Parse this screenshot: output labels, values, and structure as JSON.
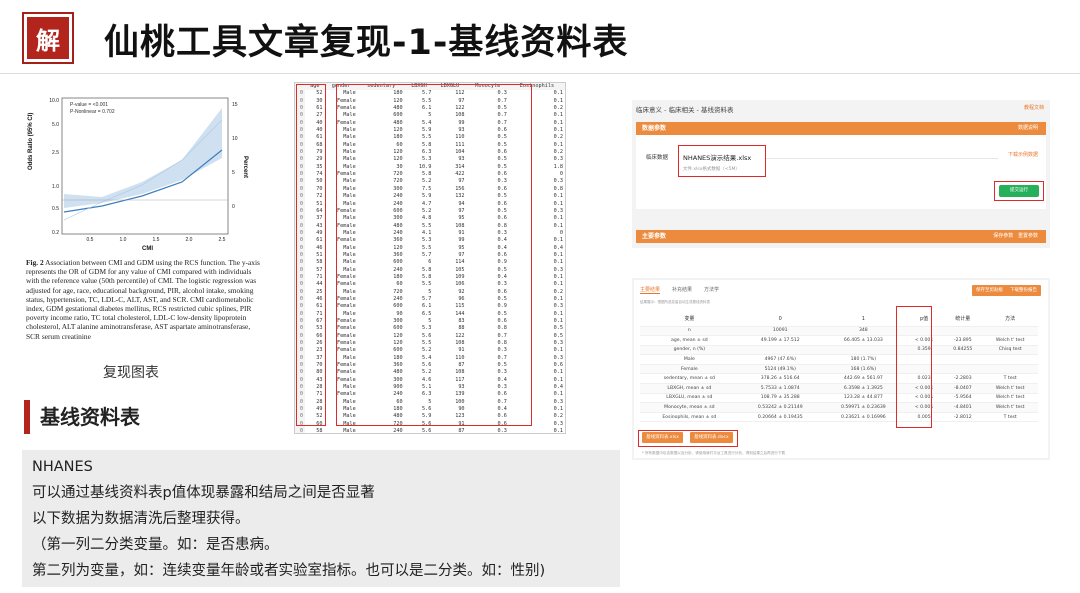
{
  "logo_glyph": "解",
  "page_title": "仙桃工具文章复现-1-基线资料表",
  "figure": {
    "stats1": "P-value = <0.001",
    "stats2": "P-Nonlinear = 0.702",
    "ylabel_left": "Odds Ratio (95% CI)",
    "ylabel_right": "Percent",
    "xlabel": "CMI",
    "y_ticks": [
      "10.0",
      "5.0",
      "2.5",
      "1.0",
      "0.5",
      "0.2"
    ],
    "x_ticks": [
      "0.5",
      "1.0",
      "1.5",
      "2.0",
      "2.5"
    ],
    "right_ticks": [
      "15",
      "10",
      "5",
      "0"
    ],
    "caption_head": "Fig. 2",
    "caption": "Association between CMI and GDM using the RCS function. The y-axis represents the OR of GDM for any value of CMI compared with individuals with the reference value (50th percentile) of CMI. The logistic regression was adjusted for age, race, educational background, PIR, alcohol intake, smoking status, hypertension, TC, LDL-C, ALT, AST, and SCR. CMI cardiometabolic index, GDM gestational diabetes mellitus, RCS restricted cubic splines, PIR poverty income ratio, TC total cholesterol, LDL-C low-density lipoprotein cholesterol, ALT alanine aminotransferase, AST aspartate aminotransferase, SCR serum creatinine",
    "label": "复现图表"
  },
  "section_title": "基线资料表",
  "notes": [
    "NHANES",
    "可以通过基线资料表p值体现暴露和结局之间是否显著",
    "以下数据为数据清洗后整理获得。",
    "（第一列二分类变量。如：是否患病。",
    "第二列为变量，如：连续变量年龄或者实验室指标。也可以是二分类。如：性别)"
  ],
  "sheet": {
    "headers": [
      "",
      "age",
      "gender",
      "sedentary",
      "LBXGH",
      "LBXGLU",
      "Monocyte",
      "Eosinophils"
    ],
    "rows": [
      [
        "0",
        "52",
        "Male",
        "180",
        "5.7",
        "112",
        "0.3",
        "0.1"
      ],
      [
        "0",
        "30",
        "Female",
        "120",
        "5.5",
        "97",
        "0.7",
        "0.1"
      ],
      [
        "0",
        "61",
        "Female",
        "480",
        "6.1",
        "122",
        "0.5",
        "0.2"
      ],
      [
        "0",
        "27",
        "Male",
        "600",
        "5",
        "108",
        "0.7",
        "0.1"
      ],
      [
        "0",
        "40",
        "Female",
        "480",
        "5.4",
        "99",
        "0.7",
        "0.1"
      ],
      [
        "0",
        "40",
        "Male",
        "120",
        "5.9",
        "93",
        "0.6",
        "0.1"
      ],
      [
        "0",
        "61",
        "Male",
        "180",
        "5.5",
        "110",
        "0.5",
        "0.2"
      ],
      [
        "0",
        "68",
        "Male",
        "60",
        "5.8",
        "111",
        "0.5",
        "0.1"
      ],
      [
        "0",
        "79",
        "Male",
        "120",
        "6.3",
        "104",
        "0.6",
        "0.2"
      ],
      [
        "0",
        "29",
        "Male",
        "120",
        "5.3",
        "93",
        "0.5",
        "0.3"
      ],
      [
        "0",
        "35",
        "Male",
        "30",
        "10.9",
        "314",
        "0.5",
        "1.8"
      ],
      [
        "0",
        "74",
        "Female",
        "720",
        "5.8",
        "422",
        "0.6",
        "0"
      ],
      [
        "0",
        "50",
        "Male",
        "720",
        "5.2",
        "97",
        "0.3",
        "0.3"
      ],
      [
        "0",
        "70",
        "Male",
        "300",
        "7.5",
        "156",
        "0.6",
        "0.8"
      ],
      [
        "0",
        "72",
        "Male",
        "240",
        "5.9",
        "132",
        "0.5",
        "0.1"
      ],
      [
        "0",
        "51",
        "Male",
        "240",
        "4.7",
        "94",
        "0.6",
        "0.1"
      ],
      [
        "0",
        "64",
        "Female",
        "600",
        "5.2",
        "97",
        "0.5",
        "0.3"
      ],
      [
        "0",
        "37",
        "Male",
        "300",
        "4.8",
        "95",
        "0.6",
        "0.1"
      ],
      [
        "0",
        "43",
        "Female",
        "480",
        "5.5",
        "108",
        "0.8",
        "0.1"
      ],
      [
        "0",
        "49",
        "Male",
        "240",
        "4.1",
        "91",
        "0.3",
        "0"
      ],
      [
        "0",
        "61",
        "Female",
        "360",
        "5.3",
        "99",
        "0.4",
        "0.1"
      ],
      [
        "0",
        "46",
        "Male",
        "120",
        "5.5",
        "95",
        "0.4",
        "0.4"
      ],
      [
        "0",
        "51",
        "Male",
        "360",
        "5.7",
        "97",
        "0.6",
        "0.1"
      ],
      [
        "0",
        "58",
        "Male",
        "600",
        "6",
        "114",
        "0.9",
        "0.1"
      ],
      [
        "0",
        "57",
        "Male",
        "240",
        "5.8",
        "105",
        "0.5",
        "0.3"
      ],
      [
        "0",
        "71",
        "Female",
        "180",
        "5.8",
        "109",
        "0.4",
        "0.1"
      ],
      [
        "0",
        "44",
        "Female",
        "60",
        "5.5",
        "106",
        "0.3",
        "0.1"
      ],
      [
        "0",
        "25",
        "Male",
        "720",
        "5",
        "92",
        "0.6",
        "0.2"
      ],
      [
        "0",
        "46",
        "Female",
        "240",
        "5.7",
        "96",
        "0.5",
        "0.1"
      ],
      [
        "0",
        "61",
        "Female",
        "600",
        "6.1",
        "115",
        "0.9",
        "0.3"
      ],
      [
        "0",
        "71",
        "Male",
        "90",
        "6.5",
        "144",
        "0.5",
        "0.1"
      ],
      [
        "0",
        "67",
        "Female",
        "300",
        "5",
        "83",
        "0.6",
        "0.1"
      ],
      [
        "0",
        "53",
        "Female",
        "600",
        "5.3",
        "88",
        "0.8",
        "0.5"
      ],
      [
        "0",
        "66",
        "Female",
        "120",
        "5.6",
        "122",
        "0.7",
        "0.5"
      ],
      [
        "0",
        "26",
        "Female",
        "120",
        "5.5",
        "108",
        "0.8",
        "0.3"
      ],
      [
        "0",
        "23",
        "Female",
        "600",
        "5.2",
        "91",
        "0.3",
        "0.1"
      ],
      [
        "0",
        "37",
        "Male",
        "180",
        "5.4",
        "110",
        "0.7",
        "0.3"
      ],
      [
        "0",
        "70",
        "Female",
        "360",
        "5.6",
        "87",
        "0.5",
        "0.6"
      ],
      [
        "0",
        "80",
        "Female",
        "480",
        "5.2",
        "108",
        "0.3",
        "0.1"
      ],
      [
        "0",
        "43",
        "Female",
        "300",
        "4.6",
        "117",
        "0.4",
        "0.1"
      ],
      [
        "0",
        "28",
        "Male",
        "900",
        "5.1",
        "93",
        "0.3",
        "0.4"
      ],
      [
        "0",
        "71",
        "Female",
        "240",
        "6.3",
        "139",
        "0.6",
        "0.1"
      ],
      [
        "0",
        "28",
        "Male",
        "60",
        "5",
        "100",
        "0.7",
        "0.3"
      ],
      [
        "0",
        "49",
        "Male",
        "180",
        "5.6",
        "90",
        "0.4",
        "0.1"
      ],
      [
        "0",
        "52",
        "Male",
        "480",
        "5.9",
        "123",
        "0.6",
        "0.2"
      ],
      [
        "0",
        "60",
        "Male",
        "720",
        "5.6",
        "91",
        "0.6",
        "0.3"
      ],
      [
        "0",
        "58",
        "Male",
        "240",
        "5.6",
        "87",
        "0.3",
        "0.1"
      ],
      [
        "0",
        "55",
        "Male",
        "240",
        "6",
        "98",
        "0.7",
        "0.2"
      ],
      [
        "0",
        "72",
        "Female",
        "240",
        "6.4",
        "121",
        "0.5",
        "0.3"
      ],
      [
        "0",
        "59",
        "Female",
        "300",
        "5.7",
        "104",
        "0.4",
        "0.1"
      ]
    ]
  },
  "app_top": {
    "breadcrumb": "临床意义 - 临床相关 - 基线资料表",
    "help": "教程文档",
    "bar1": "数据参数",
    "bar1_right": "数据说明",
    "field": "临床数据",
    "file_name": "NHANES演示结果.xlsx",
    "file_hint": "文件.xlsx格式数据（<5M）",
    "download": "下载示例数据",
    "run": "提交运行",
    "bar2": "主要参数",
    "bar2_right1": "保存参数",
    "bar2_right2": "重置参数"
  },
  "app_bot": {
    "tabs": [
      "主要结果",
      "补充结果",
      "方法学"
    ],
    "btn1": "保存至剪贴板",
    "btn2": "下载整份报告",
    "note": "结果展示：根据所选变量自动生成基线资料表",
    "headers": [
      "变量",
      "0",
      "1",
      "p值",
      "统计量",
      "方法"
    ],
    "rows": [
      [
        "n",
        "10091",
        "348",
        "",
        "",
        ""
      ],
      [
        "age, mean ± sd",
        "49.199 ± 17.512",
        "66.405 ± 13.033",
        "< 0.001",
        "-23.895",
        "Welch t' test"
      ],
      [
        "gender, n (%)",
        "",
        "",
        "0.359",
        "0.84255",
        "Chisq test"
      ],
      [
        "Male",
        "4967 (47.6%)",
        "180 (1.7%)",
        "",
        "",
        ""
      ],
      [
        "Female",
        "5124 (49.1%)",
        "168 (1.6%)",
        "",
        "",
        ""
      ],
      [
        "sedentary, mean ± sd",
        "378.26 ± 516.64",
        "442.69 ± 561.97",
        "0.023",
        "-2.2803",
        "T test"
      ],
      [
        "LBXGH, mean ± sd",
        "5.7533 ± 1.0874",
        "6.3598 ± 1.3925",
        "< 0.001",
        "-8.0407",
        "Welch t' test"
      ],
      [
        "LBXGLU, mean ± sd",
        "108.79 ± 35.288",
        "123.28 ± 44.877",
        "< 0.001",
        "-5.9564",
        "Welch t' test"
      ],
      [
        "Monocyte, mean ± sd",
        "0.53242 ± 0.21149",
        "0.59971 ± 0.23639",
        "< 0.001",
        "-4.8401",
        "Welch t' test"
      ],
      [
        "Eosinophils, mean ± sd",
        "0.20664 ± 0.19435",
        "0.23621 ± 0.16996",
        "0.005",
        "-2.8012",
        "T test"
      ]
    ],
    "dl_xlsx": "基线资料表.xlsx",
    "dl_docx": "基线资料表.docx",
    "footnote": "* 所有数据中包含数据以及分析，请使用我们平台工具进行分析，得到结果之后再进行下载"
  },
  "colors": {
    "accent": "#ec8a3d",
    "highlight": "#e02a2a",
    "brand": "#b3241c",
    "run": "#27b05a"
  }
}
